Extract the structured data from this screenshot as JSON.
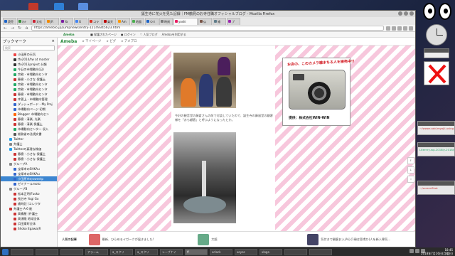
{
  "window": {
    "title": "誕生寺に花火を見た記録｜FM鶴見のお寺住職オフィシャルブログ - Mozilla Firefox"
  },
  "tabs": [
    {
      "label": "読売",
      "color": "#1d64c8"
    },
    {
      "label": "ﾈｯﾄ",
      "color": "#3a8f3a"
    },
    {
      "label": "文化",
      "color": "#c23"
    },
    {
      "label": "JR",
      "color": "#f08a00"
    },
    {
      "label": "Ya",
      "color": "#7b1fa2"
    },
    {
      "label": "G",
      "color": "#4285f4"
    },
    {
      "label": "コラ",
      "color": "#d32"
    },
    {
      "label": "楽天",
      "color": "#b00"
    },
    {
      "label": "Am",
      "color": "#ff9900"
    },
    {
      "label": "地図",
      "color": "#4caf50"
    },
    {
      "label": "ＯＥ",
      "color": "#1d64c8"
    },
    {
      "label": "時刻",
      "color": "#7b7b7b"
    },
    {
      "label": "yoshi",
      "color": "#e91e63"
    },
    {
      "label": "仏",
      "color": "#795548"
    },
    {
      "label": "雑",
      "color": "#607d8b"
    },
    {
      "label": "ブ",
      "color": "#9c27b0"
    }
  ],
  "url_bar": {
    "url": "https://ameblo.jp/jumpnews/entry-12149345623.html"
  },
  "bookmark_toolbar": {
    "brand": "Ameba",
    "items": [
      "■ 保護されたページ",
      "● ログイン",
      "♡ 人気ブログ",
      "Amebaを利用する"
    ]
  },
  "sidebar": {
    "title": "ブックマーク",
    "search_placeholder": "検索",
    "items": [
      {
        "label": "小田原の天気",
        "color": "#e44"
      },
      {
        "label": "tfo2014/tw at master",
        "color": "#333"
      },
      {
        "label": "tfo2013project 分類",
        "color": "#333"
      },
      {
        "label": "今日の市場動向(日)",
        "color": "#2a6"
      },
      {
        "label": "宗務 - 市場動向センタ",
        "color": "#2a6"
      },
      {
        "label": "春樹 - 小さな 保護土",
        "color": "#c33"
      },
      {
        "label": "宗務 - 市場動向センタ",
        "color": "#2a6"
      },
      {
        "label": "宗務 - 市場動向センタ",
        "color": "#2a6"
      },
      {
        "label": "春樹 - 市場動向センタ",
        "color": "#c33"
      },
      {
        "label": "木曽上 - 市場動向管理",
        "color": "#c33"
      },
      {
        "label": "ダッシュボード - My Proj",
        "color": "#36c"
      },
      {
        "label": "市場動向ページ 初期",
        "color": "#36c"
      },
      {
        "label": "Blogger: 市場動向セン",
        "color": "#f60"
      },
      {
        "label": "春樹 - 清楽, 光楽",
        "color": "#c33"
      },
      {
        "label": "春樹 - 清楽 保護土",
        "color": "#c33"
      },
      {
        "label": "市場動向センター 収入",
        "color": "#2a6"
      },
      {
        "label": "総務省の法規文書",
        "color": "#555"
      },
      {
        "label": "Twitter",
        "color": "#1da1f2"
      },
      {
        "label": "弁護士",
        "color": "#888"
      },
      {
        "label": "Twitterの真理な株価",
        "color": "#1da1f2"
      },
      {
        "label": "春樹 - 小さな 保護土",
        "color": "#c33"
      },
      {
        "label": "春樹 - 小さな 保護土",
        "color": "#c33"
      },
      {
        "label": "グループA",
        "color": "#888"
      },
      {
        "label": "宝塚市のSHKAu",
        "color": "#36c"
      },
      {
        "label": "宝塚市のSHKAu",
        "color": "#36c"
      },
      {
        "label": "小田原市のsweetp",
        "color": "#36c",
        "selected": true
      },
      {
        "label": "ゼミナールmoto",
        "color": "#36c"
      },
      {
        "label": "グループB",
        "color": "#888"
      },
      {
        "label": "松本正明(Fuoko",
        "color": "#c33"
      },
      {
        "label": "長谷寺 Yogi Go",
        "color": "#c33"
      },
      {
        "label": "歳時記 (コレクタ",
        "color": "#c33"
      },
      {
        "label": "弁護士 A-6 能",
        "color": "#c33"
      },
      {
        "label": "高橋屋 (弁護士",
        "color": "#c33"
      },
      {
        "label": "高須殿 地域全体",
        "color": "#c33"
      },
      {
        "label": "浜田東町全体",
        "color": "#c33"
      },
      {
        "label": "Shoko Egawa(R",
        "color": "#c33"
      }
    ]
  },
  "page": {
    "site_brand": "Ameba",
    "site_nav": [
      "▸ マイページ",
      "▸ ピグ",
      "▸ アメブロ"
    ],
    "caption1": "今好の観音堂の藤倉さんの前で対談していたので、誕生寺の藤留堂の顧客様を「おも顧客」と呼ぶようになったとか。",
    "bottom_text": "涌いまさ人類の水から出来る水が なる鉄のセンタールという親子様が",
    "ad_handwriting": "お店の、このカメラ雑まちる人を振売中!!",
    "ad_caption": "提供：株式会社WIN-WIN",
    "right_tools": [
      "↑",
      "↓",
      "☆"
    ],
    "popular_title": "人気の記事",
    "popular": [
      {
        "text": "最新、ひらめるイガークが届きました!",
        "thumb_color": "#d66"
      },
      {
        "text": "大阪",
        "thumb_color": "#6a8"
      },
      {
        "text": "気付きで観客お入(Aら(1冊は悲鳴か)人を新人寒気...",
        "thumb_color": "#446"
      }
    ]
  },
  "widgets": {
    "notes": [
      {
        "text": "~/wwwr-add-myojii-using #",
        "color": "#c33"
      },
      {
        "text": "Liternry-wp-2018ly-2018/C",
        "color": "#2a6"
      },
      {
        "text": "~/screenShot",
        "color": "#c33"
      }
    ]
  },
  "taskbar": {
    "items": [
      "",
      "",
      "",
      "アラーム",
      "a_スクリ",
      "a_スクリ",
      "レーブナイ",
      "ff",
      "xclock",
      "xeyes",
      "xlogo",
      "",
      ""
    ],
    "time": "18:45",
    "date": "2018年7月16日(月曜日)"
  }
}
